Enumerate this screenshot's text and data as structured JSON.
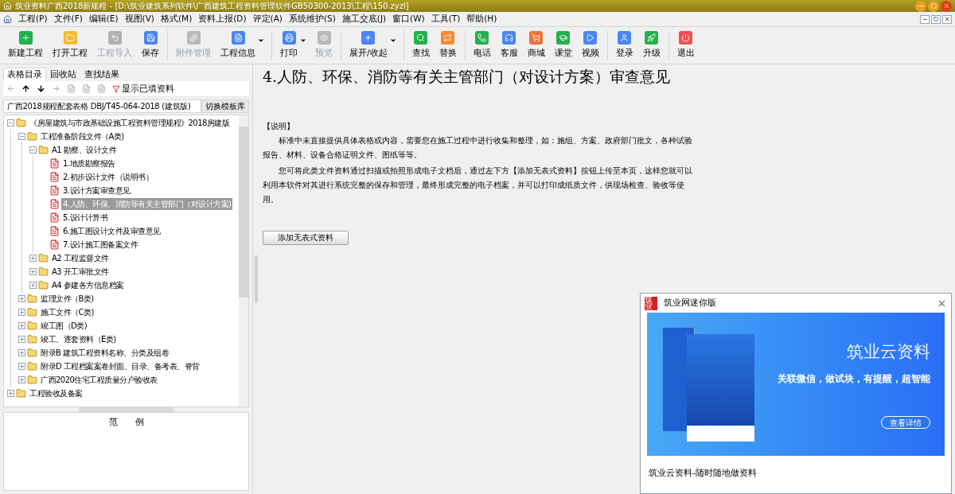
{
  "window": {
    "title": "筑业资料广西2018新规程 - [D:\\筑业建筑系列软件\\广西建筑工程资料管理软件GB50300-2013\\工程\\150.zyzl]"
  },
  "menu": [
    "工程(P)",
    "文件(F)",
    "编辑(E)",
    "视图(V)",
    "格式(M)",
    "资料上报(D)",
    "评定(A)",
    "系统维护(S)",
    "施工交底(J)",
    "窗口(W)",
    "工具(T)",
    "帮助(H)"
  ],
  "toolbar": [
    {
      "kind": "button",
      "label": "新建工程",
      "color": "#22b14c",
      "disabled": false,
      "dropdown": false
    },
    {
      "kind": "button",
      "label": "打开工程",
      "color": "#f5b82e",
      "disabled": false,
      "dropdown": false
    },
    {
      "kind": "button",
      "label": "工程导入",
      "color": "#b0b0b0",
      "disabled": true,
      "dropdown": false
    },
    {
      "kind": "button",
      "label": "保存",
      "color": "#4a86f0",
      "disabled": false,
      "dropdown": false
    },
    {
      "kind": "separator"
    },
    {
      "kind": "button",
      "label": "附件管理",
      "color": "#b8b8b8",
      "disabled": true,
      "dropdown": false
    },
    {
      "kind": "button",
      "label": "工程信息",
      "color": "#4a86f0",
      "disabled": false,
      "dropdown": true
    },
    {
      "kind": "separator"
    },
    {
      "kind": "button",
      "label": "打印",
      "color": "#4a86f0",
      "disabled": false,
      "dropdown": true
    },
    {
      "kind": "button",
      "label": "预览",
      "color": "#b8b8b8",
      "disabled": true,
      "dropdown": false
    },
    {
      "kind": "separator"
    },
    {
      "kind": "button",
      "label": "展开/收起",
      "color": "#4a86f0",
      "disabled": false,
      "dropdown": true
    },
    {
      "kind": "separator"
    },
    {
      "kind": "button",
      "label": "查找",
      "color": "#22b14c",
      "disabled": false,
      "dropdown": false
    },
    {
      "kind": "button",
      "label": "替换",
      "color": "#f58a2e",
      "disabled": false,
      "dropdown": false
    },
    {
      "kind": "separator"
    },
    {
      "kind": "button",
      "label": "电话",
      "color": "#22b14c",
      "disabled": false,
      "dropdown": false
    },
    {
      "kind": "button",
      "label": "客服",
      "color": "#4a86f0",
      "disabled": false,
      "dropdown": false
    },
    {
      "kind": "button",
      "label": "商城",
      "color": "#f0703c",
      "disabled": false,
      "dropdown": false
    },
    {
      "kind": "button",
      "label": "课堂",
      "color": "#22b14c",
      "disabled": false,
      "dropdown": false
    },
    {
      "kind": "button",
      "label": "视频",
      "color": "#4a86f0",
      "disabled": false,
      "dropdown": false
    },
    {
      "kind": "separator"
    },
    {
      "kind": "button",
      "label": "登录",
      "color": "#4a86f0",
      "disabled": false,
      "dropdown": false
    },
    {
      "kind": "button",
      "label": "升级",
      "color": "#22b14c",
      "disabled": false,
      "dropdown": false
    },
    {
      "kind": "separator"
    },
    {
      "kind": "button",
      "label": "退出",
      "color": "#f05050",
      "disabled": false,
      "dropdown": false
    }
  ],
  "sidebar": {
    "tabs": [
      {
        "label": "表格目录",
        "selected": true
      },
      {
        "label": "回收站",
        "selected": false
      },
      {
        "label": "查找结果",
        "selected": false
      }
    ],
    "filter_label": "显示已填资料",
    "template": "广西2018规程配套表格 DBJ/T45-064-2018 (建筑版)",
    "switch_button": "切换模板库",
    "tree": [
      {
        "kind": "folder",
        "label": "《房屋建筑与市政基础设施工程资料管理规程》2018房建版",
        "expanded": true,
        "selected": false,
        "children": [
          {
            "kind": "folder",
            "label": "工程准备阶段文件（A类)",
            "expanded": true,
            "selected": false,
            "children": [
              {
                "kind": "folder",
                "label": "A1 勘察、设计文件",
                "expanded": true,
                "selected": false,
                "children": [
                  {
                    "kind": "doc",
                    "label": "1.地质勘察报告",
                    "selected": false
                  },
                  {
                    "kind": "doc",
                    "label": "2.初步设计文件（说明书）",
                    "selected": false
                  },
                  {
                    "kind": "doc",
                    "label": "3.设计方案审查意见",
                    "selected": false
                  },
                  {
                    "kind": "doc",
                    "label": "4.人防、环保、消防等有关主管部门（对设计方案)",
                    "selected": true
                  },
                  {
                    "kind": "doc",
                    "label": "5.设计计算书",
                    "selected": false
                  },
                  {
                    "kind": "doc",
                    "label": "6.施工图设计文件及审查意见",
                    "selected": false
                  },
                  {
                    "kind": "doc",
                    "label": "7.设计施工图备案文件",
                    "selected": false
                  }
                ]
              },
              {
                "kind": "folder",
                "label": "A2 工程监督文件",
                "expanded": false,
                "selected": false
              },
              {
                "kind": "folder",
                "label": "A3 开工审批文件",
                "expanded": false,
                "selected": false
              },
              {
                "kind": "folder",
                "label": "A4 参建各方信息档案",
                "expanded": false,
                "selected": false
              }
            ]
          },
          {
            "kind": "folder",
            "label": "监理文件（B类)",
            "expanded": false,
            "selected": false
          },
          {
            "kind": "folder",
            "label": "施工文件（C类)",
            "expanded": false,
            "selected": false
          },
          {
            "kind": "folder",
            "label": "竣工图（D类)",
            "expanded": false,
            "selected": false
          },
          {
            "kind": "folder",
            "label": "竣工、逐套资料（E类)",
            "expanded": false,
            "selected": false
          },
          {
            "kind": "folder",
            "label": "附录B 建筑工程资料名称、分类及组卷",
            "expanded": false,
            "selected": false
          },
          {
            "kind": "folder",
            "label": "附录D 工程档案案卷封面、目录、备考表、脊背",
            "expanded": false,
            "selected": false
          },
          {
            "kind": "folder",
            "label": "广西2020住宅工程质量分户验收表",
            "expanded": false,
            "selected": false
          }
        ]
      },
      {
        "kind": "folder",
        "label": "工程验收及备案",
        "expanded": false,
        "selected": false
      }
    ],
    "legend_title": "范　　例"
  },
  "content": {
    "title": "4.人防、环保、消防等有关主管部门（对设计方案）审查意见",
    "note_heading": "【说明】",
    "paragraphs": [
      "标准中未直接提供具体表格或内容，需要您在施工过程中进行收集和整理，如：施组、方案、政府部门批文，各种试验报告、材料、设备合格证明文件、图纸等等。",
      "您可将此类文件资料通过扫描或拍照形成电子文档后，通过左下方【添加无表式资料】按钮上传至本页，这样您就可以利用本软件对其进行系统完整的保存和管理，最终形成完整的电子档案，并可以打印成纸质文件，供现场检查、验收等使用。"
    ],
    "add_button": "添加无表式资料"
  },
  "popup": {
    "title": "筑业网迷你版",
    "logo": "筑业",
    "banner_title": "筑业云资料",
    "banner_subtitle": "关联微信，做试块，有提醒，超智能",
    "banner_button": "查看详情",
    "caption": "筑业云资料-随时随地做资料"
  }
}
